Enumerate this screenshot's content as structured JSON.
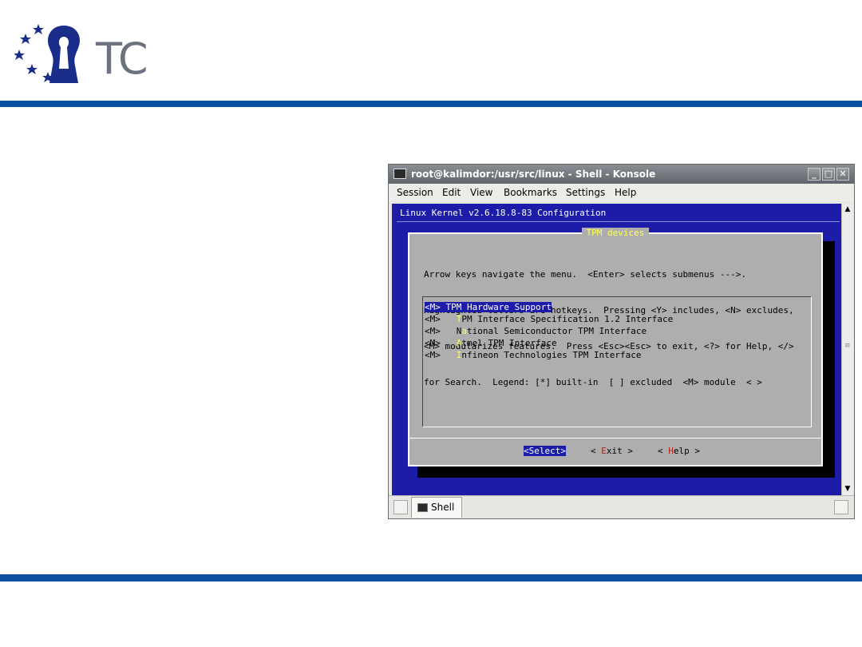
{
  "logo": {
    "text": "TC",
    "icon": "keyhole-stars-logo"
  },
  "window": {
    "title": "root@kalimdor:/usr/src/linux - Shell - Konsole",
    "menu": [
      "Session",
      "Edit",
      "View",
      "Bookmarks",
      "Settings",
      "Help"
    ]
  },
  "terminal": {
    "header": "Linux Kernel v2.6.18.8-83 Configuration",
    "dialog_title": "TPM devices",
    "help_lines": [
      "Arrow keys navigate the menu.  <Enter> selects submenus --->.",
      "Highlighted letters are hotkeys.  Pressing <Y> includes, <N> excludes,",
      "<M> modularizes features.  Press <Esc><Esc> to exit, <?> for Help, </>",
      "for Search.  Legend: [*] built-in  [ ] excluded  <M> module  < >"
    ],
    "items": [
      {
        "state": "<M>",
        "label": "TPM Hardware Support",
        "selected": true
      },
      {
        "state": "<M>",
        "hotkey": "T",
        "rest": "PM Interface Specification 1.2 Interface"
      },
      {
        "state": "<M>",
        "pre": "N",
        "hotkey": "a",
        "rest": "tional Semiconductor TPM Interface"
      },
      {
        "state": "<M>",
        "hotkey": "A",
        "rest": "tmel TPM Interface"
      },
      {
        "state": "<M>",
        "hotkey": "I",
        "rest": "nfineon Technologies TPM Interface"
      }
    ],
    "buttons": {
      "select": "<Select>",
      "exit_pre": "< ",
      "exit_hot": "E",
      "exit_rest": "xit >",
      "help_pre": "< ",
      "help_hot": "H",
      "help_rest": "elp >"
    }
  },
  "tabs": [
    {
      "label": "Shell",
      "icon": "terminal-icon"
    }
  ],
  "colors": {
    "brand_rule": "#0a4fa0",
    "terminal_bg": "#1c1ca8",
    "dialog_bg": "#aeaeae",
    "hotkey": "#ffff55"
  }
}
